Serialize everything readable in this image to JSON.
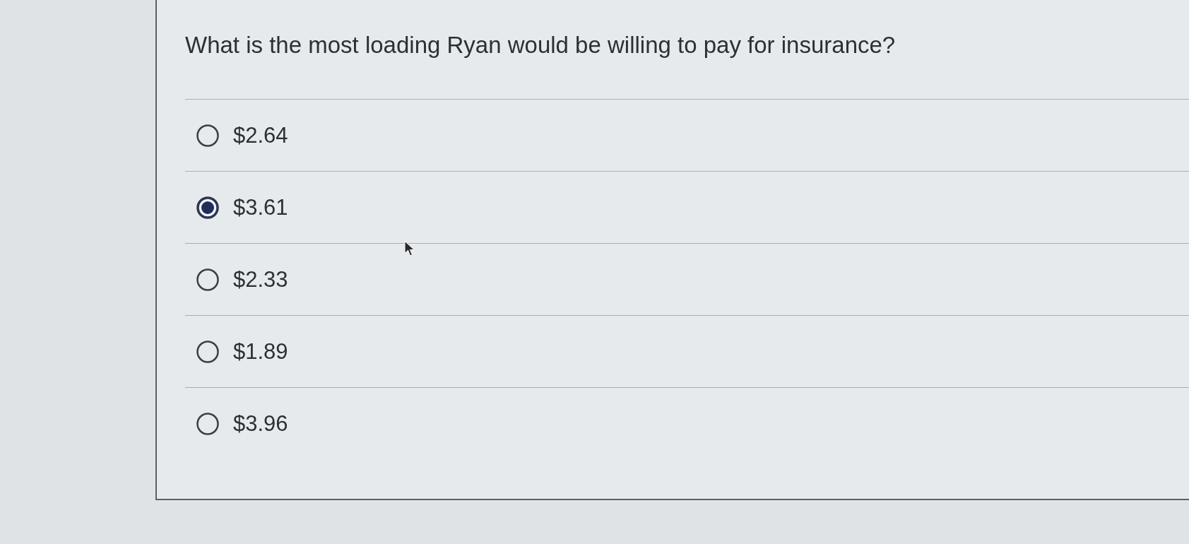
{
  "question": {
    "text": "What is the most loading Ryan would be willing to pay for insurance?"
  },
  "options": [
    {
      "label": "$2.64",
      "selected": false
    },
    {
      "label": "$3.61",
      "selected": true
    },
    {
      "label": "$2.33",
      "selected": false
    },
    {
      "label": "$1.89",
      "selected": false
    },
    {
      "label": "$3.96",
      "selected": false
    }
  ]
}
